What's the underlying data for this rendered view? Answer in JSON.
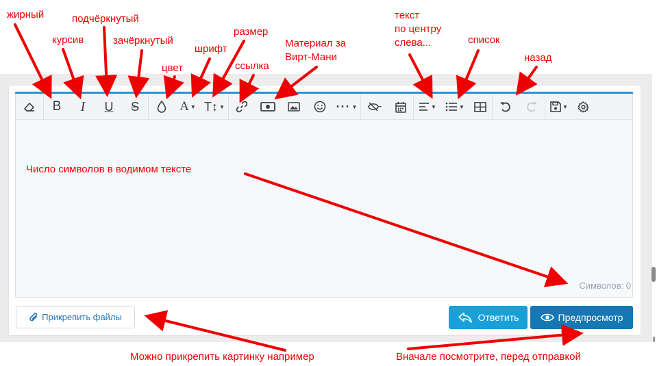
{
  "annotations": {
    "bold": "жирный",
    "italic": "курсив",
    "underline": "подчёркнутый",
    "strike": "зачёркнутый",
    "color": "цвет",
    "font": "шрифт",
    "size": "размер",
    "link": "ссылка",
    "material": "Материал за\nВирт-Мани",
    "align": "текст\nпо центру\nслева...",
    "list": "список",
    "undo": "назад",
    "char_count_note": "Число символов в водимом тексте",
    "attach_note": "Можно прикрепить картинку например",
    "preview_note": "Вначале посмотрите, перед отправкой"
  },
  "toolbar": {
    "bold_glyph": "B",
    "italic_glyph": "I",
    "underline_glyph": "U",
    "strike_glyph": "S",
    "font_glyph": "A",
    "size_glyph": "T↕",
    "more_glyph": "···",
    "icons": [
      "eraser-icon",
      "bold-icon",
      "italic-icon",
      "underline-icon",
      "strikethrough-icon",
      "color-drop-icon",
      "font-icon",
      "font-size-icon",
      "link-icon",
      "money-icon",
      "image-icon",
      "smiley-icon",
      "more-icon",
      "hide-icon",
      "calendar-icon",
      "align-icon",
      "list-icon",
      "table-icon",
      "undo-icon",
      "redo-icon",
      "save-draft-icon",
      "gear-icon"
    ]
  },
  "editor": {
    "char_count": "Символов: 0"
  },
  "buttons": {
    "attach": "Прикрепить файлы",
    "reply": "Ответить",
    "preview": "Предпросмотр"
  },
  "colors": {
    "accent_line": "#2592d0",
    "reply_bg": "#1aa0d8",
    "preview_bg": "#1577b3",
    "annotation": "#ee0000"
  }
}
